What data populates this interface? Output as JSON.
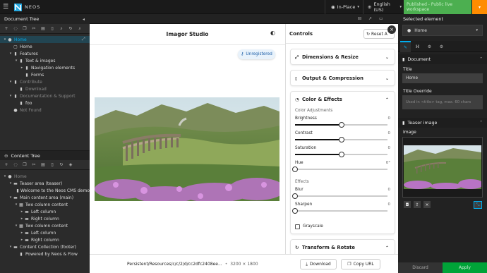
{
  "app": {
    "brand": "NEOS",
    "mode": "In-Place",
    "language": "English (US)",
    "publish_label": "Published - Public live workspace"
  },
  "doc_tree": {
    "title": "Document Tree",
    "items": [
      {
        "label": "Home",
        "depth": 0,
        "caret": "▾",
        "icon": "●",
        "state": "sel"
      },
      {
        "label": "Home",
        "depth": 1,
        "caret": "",
        "icon": "▢",
        "state": ""
      },
      {
        "label": "Features",
        "depth": 1,
        "caret": "▾",
        "icon": "▮",
        "state": ""
      },
      {
        "label": "Text & images",
        "depth": 2,
        "caret": "▾",
        "icon": "▮",
        "state": ""
      },
      {
        "label": "Navigation elements",
        "depth": 3,
        "caret": "▸",
        "icon": "▮",
        "state": ""
      },
      {
        "label": "Forms",
        "depth": 3,
        "caret": "",
        "icon": "▮",
        "state": ""
      },
      {
        "label": "Contribute",
        "depth": 1,
        "caret": "▾",
        "icon": "▮",
        "state": "dim"
      },
      {
        "label": "Download",
        "depth": 2,
        "caret": "",
        "icon": "▮",
        "state": "dim"
      },
      {
        "label": "Documentation & Support",
        "depth": 1,
        "caret": "▾",
        "icon": "▮",
        "state": "dim"
      },
      {
        "label": "foo",
        "depth": 2,
        "caret": "",
        "icon": "▮",
        "state": ""
      },
      {
        "label": "Not Found",
        "depth": 1,
        "caret": "",
        "icon": "●",
        "state": "dim"
      }
    ]
  },
  "content_tree": {
    "title": "Content Tree",
    "items": [
      {
        "label": "Home",
        "depth": 0,
        "caret": "▾",
        "icon": "●",
        "state": "dim"
      },
      {
        "label": "Teaser area (teaser)",
        "depth": 1,
        "caret": "▾",
        "icon": "▬",
        "state": ""
      },
      {
        "label": "Welcome to the Neos CMS demo",
        "depth": 2,
        "caret": "",
        "icon": "▮",
        "state": ""
      },
      {
        "label": "Main content area (main)",
        "depth": 1,
        "caret": "▾",
        "icon": "▬",
        "state": ""
      },
      {
        "label": "Two column content",
        "depth": 2,
        "caret": "▾",
        "icon": "▦",
        "state": ""
      },
      {
        "label": "Left column",
        "depth": 3,
        "caret": "▸",
        "icon": "▬",
        "state": ""
      },
      {
        "label": "Right column",
        "depth": 3,
        "caret": "▸",
        "icon": "▬",
        "state": ""
      },
      {
        "label": "Two column content",
        "depth": 2,
        "caret": "▾",
        "icon": "▦",
        "state": ""
      },
      {
        "label": "Left column",
        "depth": 3,
        "caret": "▸",
        "icon": "▬",
        "state": ""
      },
      {
        "label": "Right column",
        "depth": 3,
        "caret": "▸",
        "icon": "▬",
        "state": ""
      },
      {
        "label": "Content Collection (footer)",
        "depth": 1,
        "caret": "▾",
        "icon": "▬",
        "state": ""
      },
      {
        "label": "Powered by Neos & Flow",
        "depth": 2,
        "caret": "",
        "icon": "▮",
        "state": ""
      }
    ]
  },
  "studio": {
    "title": "Imagor Studio",
    "badge": "Unregistered",
    "image_path": "Persistent/Resources/c/c/2/d/cc2dfc2408ee...",
    "image_dims": "3200 × 1800",
    "download": "Download",
    "copy_url": "Copy URL"
  },
  "controls": {
    "title": "Controls",
    "reset": "Reset A",
    "dimensions": "Dimensions & Resize",
    "output": "Output & Compression",
    "color": "Color & Effects",
    "color_adj": "Color Adjustments",
    "effects": "Effects",
    "transform": "Transform & Rotate",
    "grayscale": "Grayscale",
    "sliders": [
      {
        "label": "Brightness",
        "value": "0",
        "pos": 0.5
      },
      {
        "label": "Contrast",
        "value": "0",
        "pos": 0.5
      },
      {
        "label": "Saturation",
        "value": "0",
        "pos": 0.5
      },
      {
        "label": "Hue",
        "value": "0°",
        "pos": 0.0
      },
      {
        "label": "Blur",
        "value": "0",
        "pos": 0.0
      },
      {
        "label": "Sharpen",
        "value": "0",
        "pos": 0.0
      }
    ]
  },
  "inspector": {
    "title": "Selected element",
    "selected": "Home",
    "doc_section": "Document",
    "title_label": "Title",
    "title_value": "Home",
    "override_label": "Title Override",
    "override_placeholder": "Used in <title> tag, max. 60 chars",
    "teaser_section": "Teaser image",
    "image_label": "Image",
    "discard": "Discard",
    "apply": "Apply"
  },
  "colors": {
    "accent": "#00adee",
    "publish": "#4caf50",
    "apply": "#00a338"
  }
}
